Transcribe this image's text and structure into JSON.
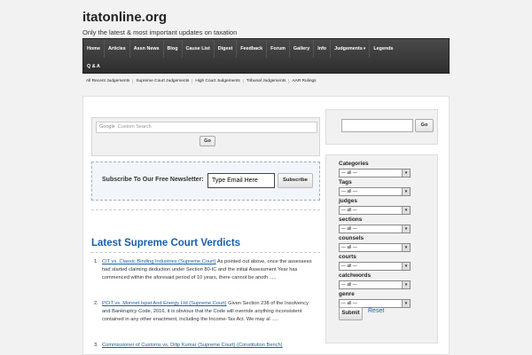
{
  "site": {
    "title": "itatonline.org",
    "tagline": "Only the latest & most important updates on taxation"
  },
  "main_nav": {
    "row1": [
      "Home",
      "Articles",
      "Assn News",
      "Blog",
      "Cause List",
      "Digest",
      "Feedback",
      "Forum",
      "Gallery",
      "Info",
      "Judgements",
      "Legends"
    ],
    "row2": [
      "Q & A"
    ],
    "dropdown_item": "Judgements"
  },
  "sub_nav": [
    "All Recent Judgements",
    "Supreme Court Judgements",
    "High Court Judgements",
    "Tribunal Judgements",
    "AAR Rulings"
  ],
  "custom_search": {
    "google_label": "Google",
    "placeholder": "Custom Search",
    "button_label": "Go"
  },
  "newsletter": {
    "label": "Subscribe To Our Free Newsletter:",
    "input_value": "Type Email Here",
    "button_label": "Subscribe"
  },
  "verdicts_section": {
    "heading": "Latest Supreme Court Verdicts",
    "items": [
      {
        "number": "1.",
        "link": "CIT vs. Classic Binding Industries (Supreme Court)",
        "text": "As pointed out above, once the assessees had started claiming deduction under Section 80-IC and the initial Assessment Year has commenced within the aforesaid period of 10 years, there cannot be anoth ....."
      },
      {
        "number": "2.",
        "link": "PCIT vs. Monnet Ispat And Energy Ltd (Supreme Court)",
        "text": "Given Section 238 of the Insolvency and Bankruptcy Code, 2016, it is obvious that the Code will override anything inconsistent contained in any other enactment, including the Income-Tax Act. We may al ....."
      },
      {
        "number": "3.",
        "link": "Commissioner of Customs vs. Dilip Kumar (Supreme Court) (Constitution Bench)",
        "text": ""
      }
    ]
  },
  "sidebar": {
    "search_button": "Go",
    "filters": [
      {
        "label": "Categories",
        "value": "— all —"
      },
      {
        "label": "Tags",
        "value": "— all —"
      },
      {
        "label": "judges",
        "value": "— all —"
      },
      {
        "label": "sections",
        "value": "— all —"
      },
      {
        "label": "counsels",
        "value": "— all —"
      },
      {
        "label": "courts",
        "value": "— all —"
      },
      {
        "label": "catchwords",
        "value": "— all —"
      },
      {
        "label": "genre",
        "value": "— all —"
      }
    ],
    "submit_label": "Submit",
    "reset_label": "Reset"
  },
  "colors": {
    "nav_background": "#3a3a3a",
    "link_blue": "#1a5fa5",
    "newsletter_bg": "#f2f5f9"
  }
}
